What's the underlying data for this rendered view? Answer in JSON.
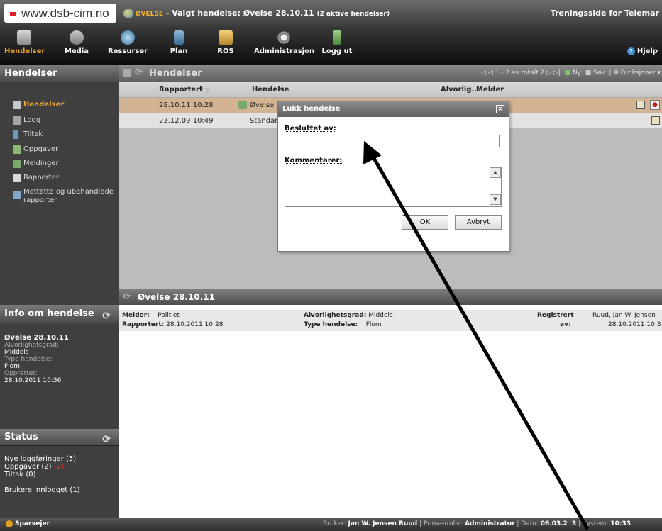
{
  "browser": {
    "url": "www.dsb-cim.no"
  },
  "header": {
    "mode_badge": "ØVELSE",
    "selected_prefix": "- Valgt hendelse: Øvelse 28.10.11",
    "active_count": "(2 aktive hendelser)",
    "site_title": "Treningsside for Telemar"
  },
  "nav": {
    "items": [
      {
        "label": "Hendelser"
      },
      {
        "label": "Media"
      },
      {
        "label": "Ressurser"
      },
      {
        "label": "Plan"
      },
      {
        "label": "ROS"
      },
      {
        "label": "Administrasjon"
      },
      {
        "label": "Logg ut"
      }
    ],
    "help": "Hjelp"
  },
  "left": {
    "hendelser_title": "Hendelser",
    "items": [
      {
        "label": "Hendelser"
      },
      {
        "label": "Logg"
      },
      {
        "label": "Tiltak"
      },
      {
        "label": "Oppgaver"
      },
      {
        "label": "Meldinger"
      },
      {
        "label": "Rapporter"
      },
      {
        "label": "Mottatte og ubehandlede rapporter"
      }
    ],
    "info_title": "Info om hendelse",
    "info": {
      "name": "Øvelse 28.10.11",
      "alvor_label": "Alvorlighetsgrad:",
      "alvor_value": "Middels",
      "type_label": "Type hendelse:",
      "type_value": "Flom",
      "opprettet_label": "Opprettet:",
      "opprettet_value": "28.10.2011 10:36"
    },
    "status_title": "Status",
    "status": {
      "logg": "Nye loggføringer (5)",
      "oppgaver": "Oppgaver (2)",
      "oppgaver_extra": "(2)",
      "tiltak": "Tiltak (0)",
      "brukere": "Brukere innlogget (1)"
    }
  },
  "grid": {
    "title": "Hendelser",
    "pager": "1 - 2 av totalt 2",
    "ny": "Ny",
    "sok": "Søk",
    "funksjoner": "Funksjoner",
    "columns": {
      "rapportert": "Rapportert",
      "hendelse": "Hendelse",
      "alvorlig": "Alvorlig...",
      "melder": "Melder"
    },
    "rows": [
      {
        "rapportert": "28.10.11 10:28",
        "hendelse": "Øvelse :"
      },
      {
        "rapportert": "23.12.09 10:49",
        "hendelse": "Standar"
      }
    ]
  },
  "detail": {
    "title": "Øvelse 28.10.11",
    "melder_label": "Melder:",
    "melder_value": "Politiet",
    "rapportert_label": "Rapportert:",
    "rapportert_value": "28.10.2011 10:28",
    "alvor_label": "Alvorlighetsgrad:",
    "alvor_value": "Middels",
    "type_label": "Type hendelse:",
    "type_value": "Flom",
    "registrert_label": "Registrert",
    "registrert_label2": "av:",
    "registrert_by": "Ruud, Jan W. Jensen",
    "registrert_date": "28.10.2011 10:3"
  },
  "dialog": {
    "title": "Lukk hendelse",
    "close": "×",
    "besluttet_label": "Besluttet av:",
    "besluttet_value": "",
    "kommentarer_label": "Kommentarer:",
    "kommentarer_value": "",
    "ok": "OK",
    "avbryt": "Avbryt"
  },
  "statusbar": {
    "sparvejer": "Sparvejer",
    "bruker_label": "Bruker:",
    "bruker": "Jan W. Jensen Ruud",
    "rolle_label": "Primærrolle:",
    "rolle": "Administrator",
    "dato_label": "Dato:",
    "dato": "06.03.2",
    "dato_tail": "3",
    "system_label": "System:",
    "system": "10:33"
  },
  "colors": {
    "accent": "#f0a630",
    "selected_row": "#d2b394",
    "annotation_arrow": "#000000"
  }
}
